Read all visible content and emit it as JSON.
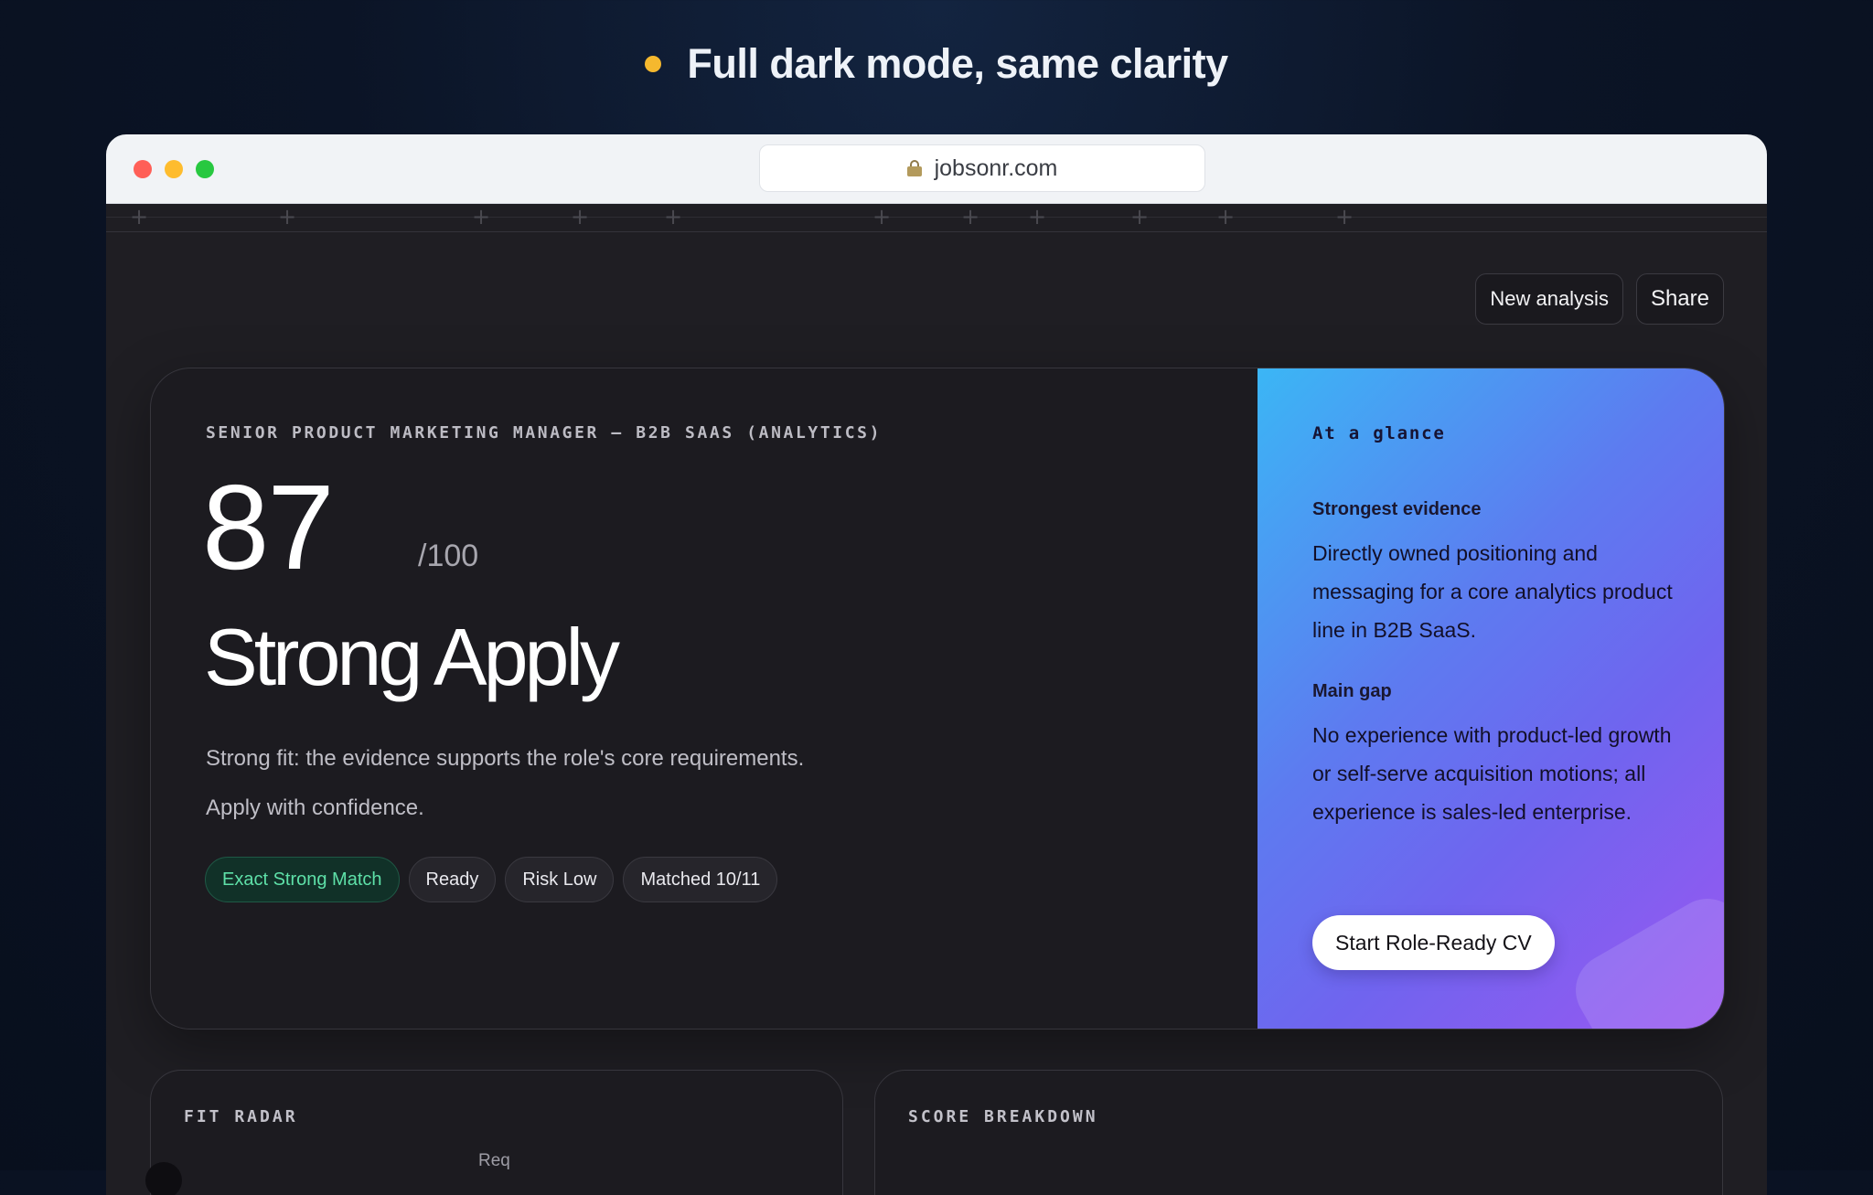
{
  "headline": {
    "text": "Full dark mode, same clarity",
    "dot_color": "#f5b82e"
  },
  "browser": {
    "url": "jobsonr.com",
    "lock_icon": "lock-icon"
  },
  "toolbar": {
    "new_analysis_label": "New analysis",
    "share_label": "Share"
  },
  "result": {
    "role_title": "SENIOR PRODUCT MARKETING MANAGER — B2B SAAS (ANALYTICS)",
    "score": "87",
    "score_max": "/100",
    "verdict": "Strong Apply",
    "description_line1": "Strong fit: the evidence supports the role's core requirements.",
    "description_line2": "Apply with confidence.",
    "badges": [
      "Exact Strong Match",
      "Ready",
      "Risk Low",
      "Matched 10/11"
    ]
  },
  "glance": {
    "title": "At a glance",
    "strongest_label": "Strongest evidence",
    "strongest_text": "Directly owned positioning and messaging for a core analytics product line in B2B SaaS.",
    "gap_label": "Main gap",
    "gap_text": "No experience with product-led growth or self-serve acquisition motions; all experience is sales-led enterprise.",
    "cta_label": "Start Role-Ready CV"
  },
  "panels": {
    "fit_radar_title": "FIT RADAR",
    "fit_radar_partial_label": "Req",
    "score_breakdown_title": "SCORE BREAKDOWN"
  },
  "colors": {
    "accent_gradient": [
      "#3bb6f5",
      "#7064ef",
      "#9a57f0"
    ],
    "match_badge": "#5ee0a8",
    "background": "#1f1e23"
  }
}
